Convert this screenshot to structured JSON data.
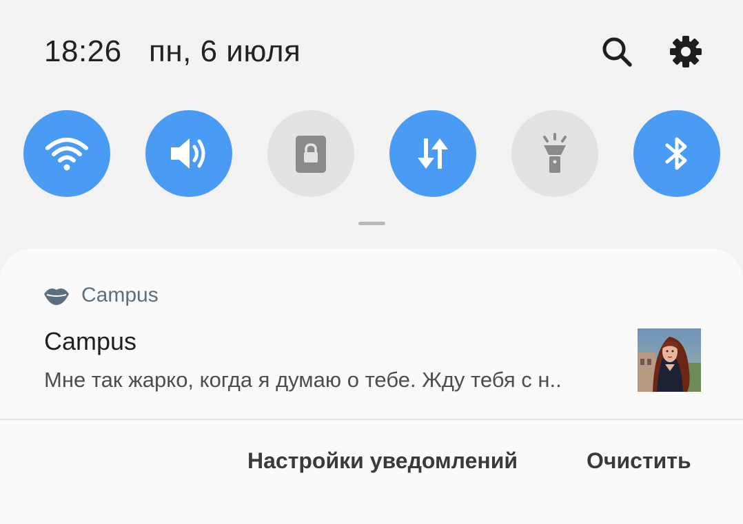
{
  "header": {
    "time": "18:26",
    "date": "пн, 6 июля",
    "icons": [
      "search-icon",
      "gear-icon"
    ]
  },
  "quick_settings": [
    {
      "name": "wifi",
      "icon": "wifi-icon",
      "state": "on"
    },
    {
      "name": "sound",
      "icon": "volume-icon",
      "state": "on"
    },
    {
      "name": "rotation-lock",
      "icon": "lock-icon",
      "state": "off"
    },
    {
      "name": "mobile-data",
      "icon": "data-arrows-icon",
      "state": "on"
    },
    {
      "name": "flashlight",
      "icon": "flashlight-icon",
      "state": "off"
    },
    {
      "name": "bluetooth",
      "icon": "bluetooth-icon",
      "state": "on"
    }
  ],
  "colors": {
    "accent": "#4a9bf4",
    "tile_off": "#e2e2e2",
    "background": "#f2f2f2",
    "card": "#fafafa"
  },
  "notification": {
    "app_name": "Campus",
    "app_icon": "lips-icon",
    "title": "Campus",
    "text": "Мне так жарко, когда я думаю о тебе. Жду тебя с н..",
    "thumbnail": "character-portrait-image"
  },
  "actions": {
    "settings_label": "Настройки уведомлений",
    "clear_label": "Очистить"
  }
}
